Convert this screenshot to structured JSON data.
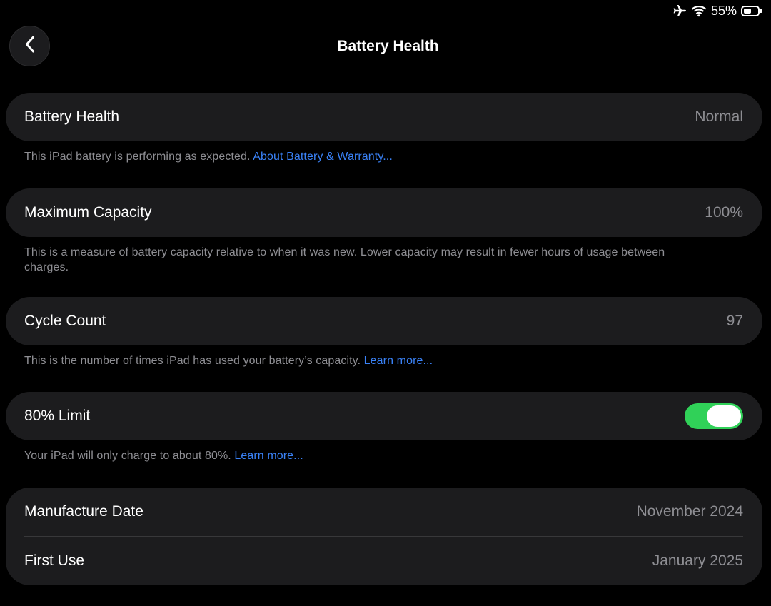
{
  "status_bar": {
    "battery_percent": "55%",
    "battery_level": 0.55,
    "icons": [
      "airplane-icon",
      "wifi-icon",
      "battery-icon"
    ]
  },
  "header": {
    "title": "Battery Health",
    "back_icon": "chevron-left-icon"
  },
  "sections": {
    "battery_health": {
      "label": "Battery Health",
      "value": "Normal",
      "footer_text": "This iPad battery is performing as expected.",
      "footer_link": "About Battery & Warranty..."
    },
    "maximum_capacity": {
      "label": "Maximum Capacity",
      "value": "100%",
      "footer_text": "This is a measure of battery capacity relative to when it was new. Lower capacity may result in fewer hours of usage between charges."
    },
    "cycle_count": {
      "label": "Cycle Count",
      "value": "97",
      "footer_text": "This is the number of times iPad has used your battery’s capacity.",
      "footer_link": "Learn more..."
    },
    "limit_80": {
      "label": "80% Limit",
      "enabled": true,
      "footer_text": "Your iPad will only charge to about 80%.",
      "footer_link": "Learn more..."
    },
    "dates": {
      "manufacture_label": "Manufacture Date",
      "manufacture_value": "November 2024",
      "first_use_label": "First Use",
      "first_use_value": "January 2025"
    }
  },
  "colors": {
    "background": "#000000",
    "card": "#1c1c1e",
    "secondary_text": "#8e8e93",
    "link": "#3a82f7",
    "toggle_on": "#30d158"
  }
}
